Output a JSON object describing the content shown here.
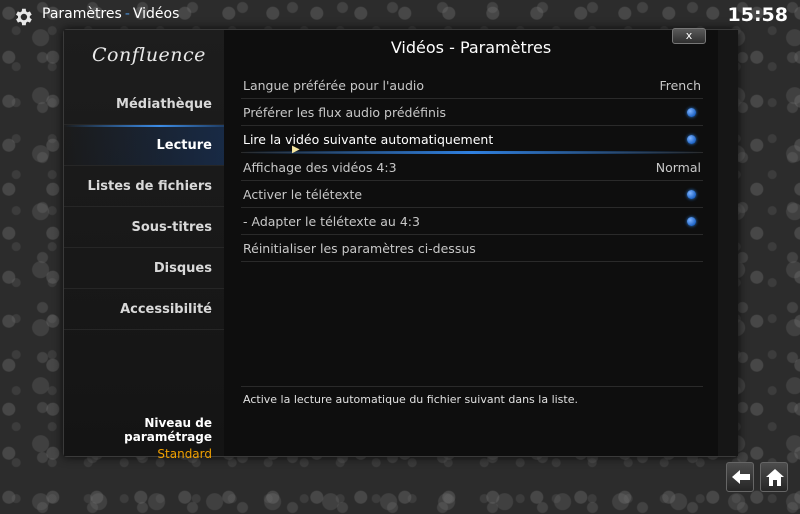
{
  "topbar": {
    "crumb_1": "Paramètres",
    "separator": "-",
    "crumb_2": "Vidéos",
    "clock": "15:58"
  },
  "sidebar": {
    "logo": "Confluence",
    "items": [
      {
        "label": "Médiathèque"
      },
      {
        "label": "Lecture"
      },
      {
        "label": "Listes de fichiers"
      },
      {
        "label": "Sous-titres"
      },
      {
        "label": "Disques"
      },
      {
        "label": "Accessibilité"
      }
    ],
    "active_index": 1,
    "level_label": "Niveau de paramétrage",
    "level_value": "Standard"
  },
  "dialog": {
    "title": "Vidéos - Paramètres",
    "close_label": "x",
    "settings": [
      {
        "label": "Langue préférée pour l'audio",
        "value": "French"
      },
      {
        "label": "Préférer les flux audio prédéfinis",
        "toggle": true
      },
      {
        "label": "Lire la vidéo suivante automatiquement",
        "toggle": true
      },
      {
        "label": "Affichage des vidéos 4:3",
        "value": "Normal"
      },
      {
        "label": "Activer le télétexte",
        "toggle": true
      },
      {
        "label": " - Adapter le télétexte au 4:3",
        "toggle": true
      },
      {
        "label": "Réinitialiser les paramètres ci-dessus"
      }
    ],
    "focused_index": 2,
    "description": "Active la lecture automatique du fichier suivant dans la liste."
  },
  "colors": {
    "accent": "#2f80e0",
    "level_value": "#f0a000"
  },
  "icons": {
    "settings": "gear-icon",
    "back": "back-arrow-icon",
    "home": "home-icon"
  }
}
